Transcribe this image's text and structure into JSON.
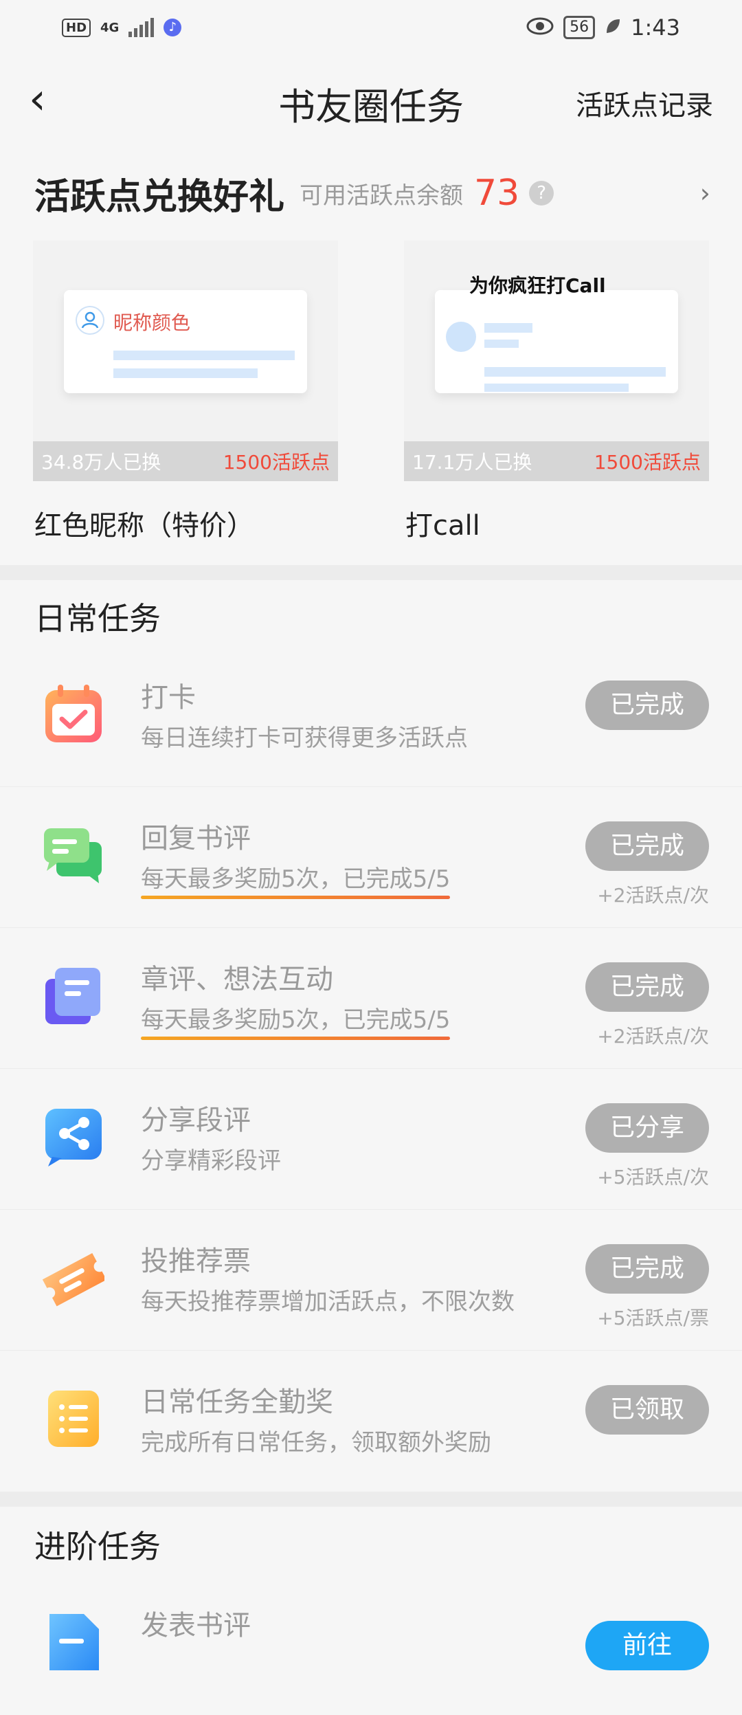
{
  "status_bar": {
    "hd_label": "HD",
    "network_label": "4G",
    "battery": "56",
    "time": "1:43"
  },
  "header": {
    "title": "书友圈任务",
    "right_link": "活跃点记录"
  },
  "exchange": {
    "title": "活跃点兑换好礼",
    "balance_label": "可用活跃点余额",
    "balance": "73",
    "help_icon": "?",
    "items": [
      {
        "preview_text": "昵称颜色",
        "exchanged": "34.8万人已换",
        "price": "1500活跃点",
        "name": "红色昵称（特价）"
      },
      {
        "preview_text": "为你疯狂打Call",
        "exchanged": "17.1万人已换",
        "price": "1500活跃点",
        "name": "打call"
      }
    ]
  },
  "daily": {
    "title": "日常任务",
    "tasks": [
      {
        "icon": "calendar-check-icon",
        "title": "打卡",
        "desc": "每日连续打卡可获得更多活跃点",
        "button": "已完成",
        "reward": ""
      },
      {
        "icon": "chat-bubbles-icon",
        "title": "回复书评",
        "desc": "每天最多奖励5次，已完成5/5",
        "button": "已完成",
        "reward": "+2活跃点/次"
      },
      {
        "icon": "document-stack-icon",
        "title": "章评、想法互动",
        "desc": "每天最多奖励5次，已完成5/5",
        "button": "已完成",
        "reward": "+2活跃点/次"
      },
      {
        "icon": "share-icon",
        "title": "分享段评",
        "desc": "分享精彩段评",
        "button": "已分享",
        "reward": "+5活跃点/次"
      },
      {
        "icon": "ticket-icon",
        "title": "投推荐票",
        "desc": "每天投推荐票增加活跃点，不限次数",
        "button": "已完成",
        "reward": "+5活跃点/票"
      },
      {
        "icon": "list-icon",
        "title": "日常任务全勤奖",
        "desc": "完成所有日常任务，领取额外奖励",
        "button": "已领取",
        "reward": ""
      }
    ]
  },
  "advanced": {
    "title": "进阶任务",
    "tasks": [
      {
        "icon": "document-icon",
        "title": "发表书评",
        "button": "前往"
      }
    ]
  },
  "colors": {
    "accent_red": "#f04a3a",
    "button_gray": "#b0b0b0",
    "button_blue": "#1ea6f5"
  }
}
